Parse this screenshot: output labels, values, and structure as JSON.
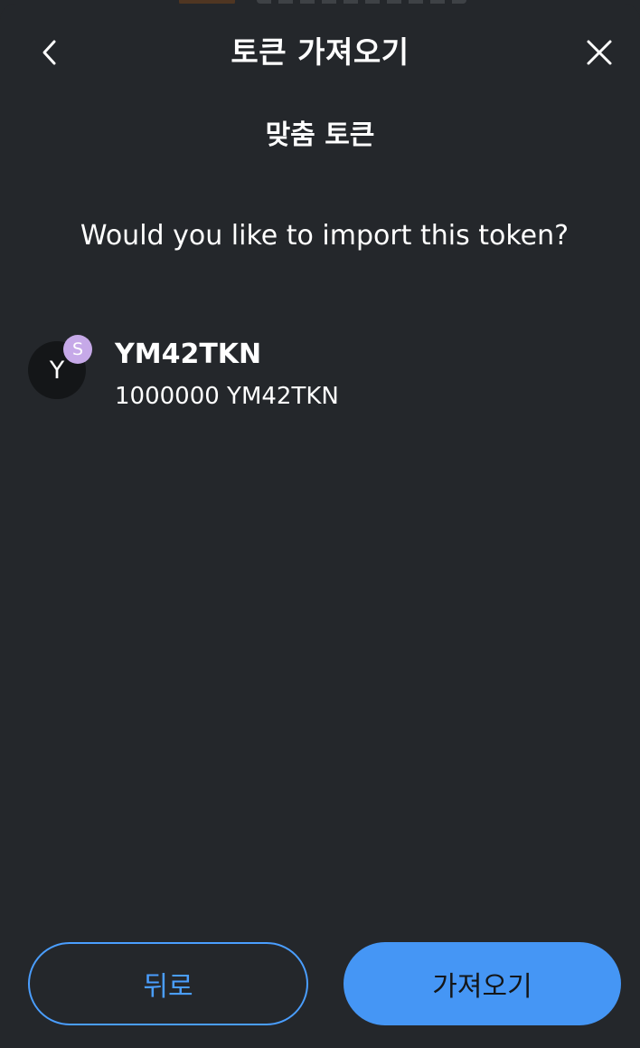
{
  "header": {
    "title": "토큰 가져오기",
    "back_icon": "chevron-left-icon",
    "close_icon": "close-icon"
  },
  "tab": {
    "label": "맞춤 토큰"
  },
  "prompt": {
    "question": "Would you like to import this token?"
  },
  "token": {
    "avatar_letter": "Y",
    "network_badge_letter": "S",
    "symbol": "YM42TKN",
    "balance": "1000000 YM42TKN"
  },
  "footer": {
    "back_label": "뒤로",
    "import_label": "가져오기"
  },
  "colors": {
    "background": "#24272b",
    "primary": "#4596f5",
    "primary_outline": "#4a9eff",
    "avatar_bg": "#141618",
    "network_badge": "#c6a9e8"
  }
}
